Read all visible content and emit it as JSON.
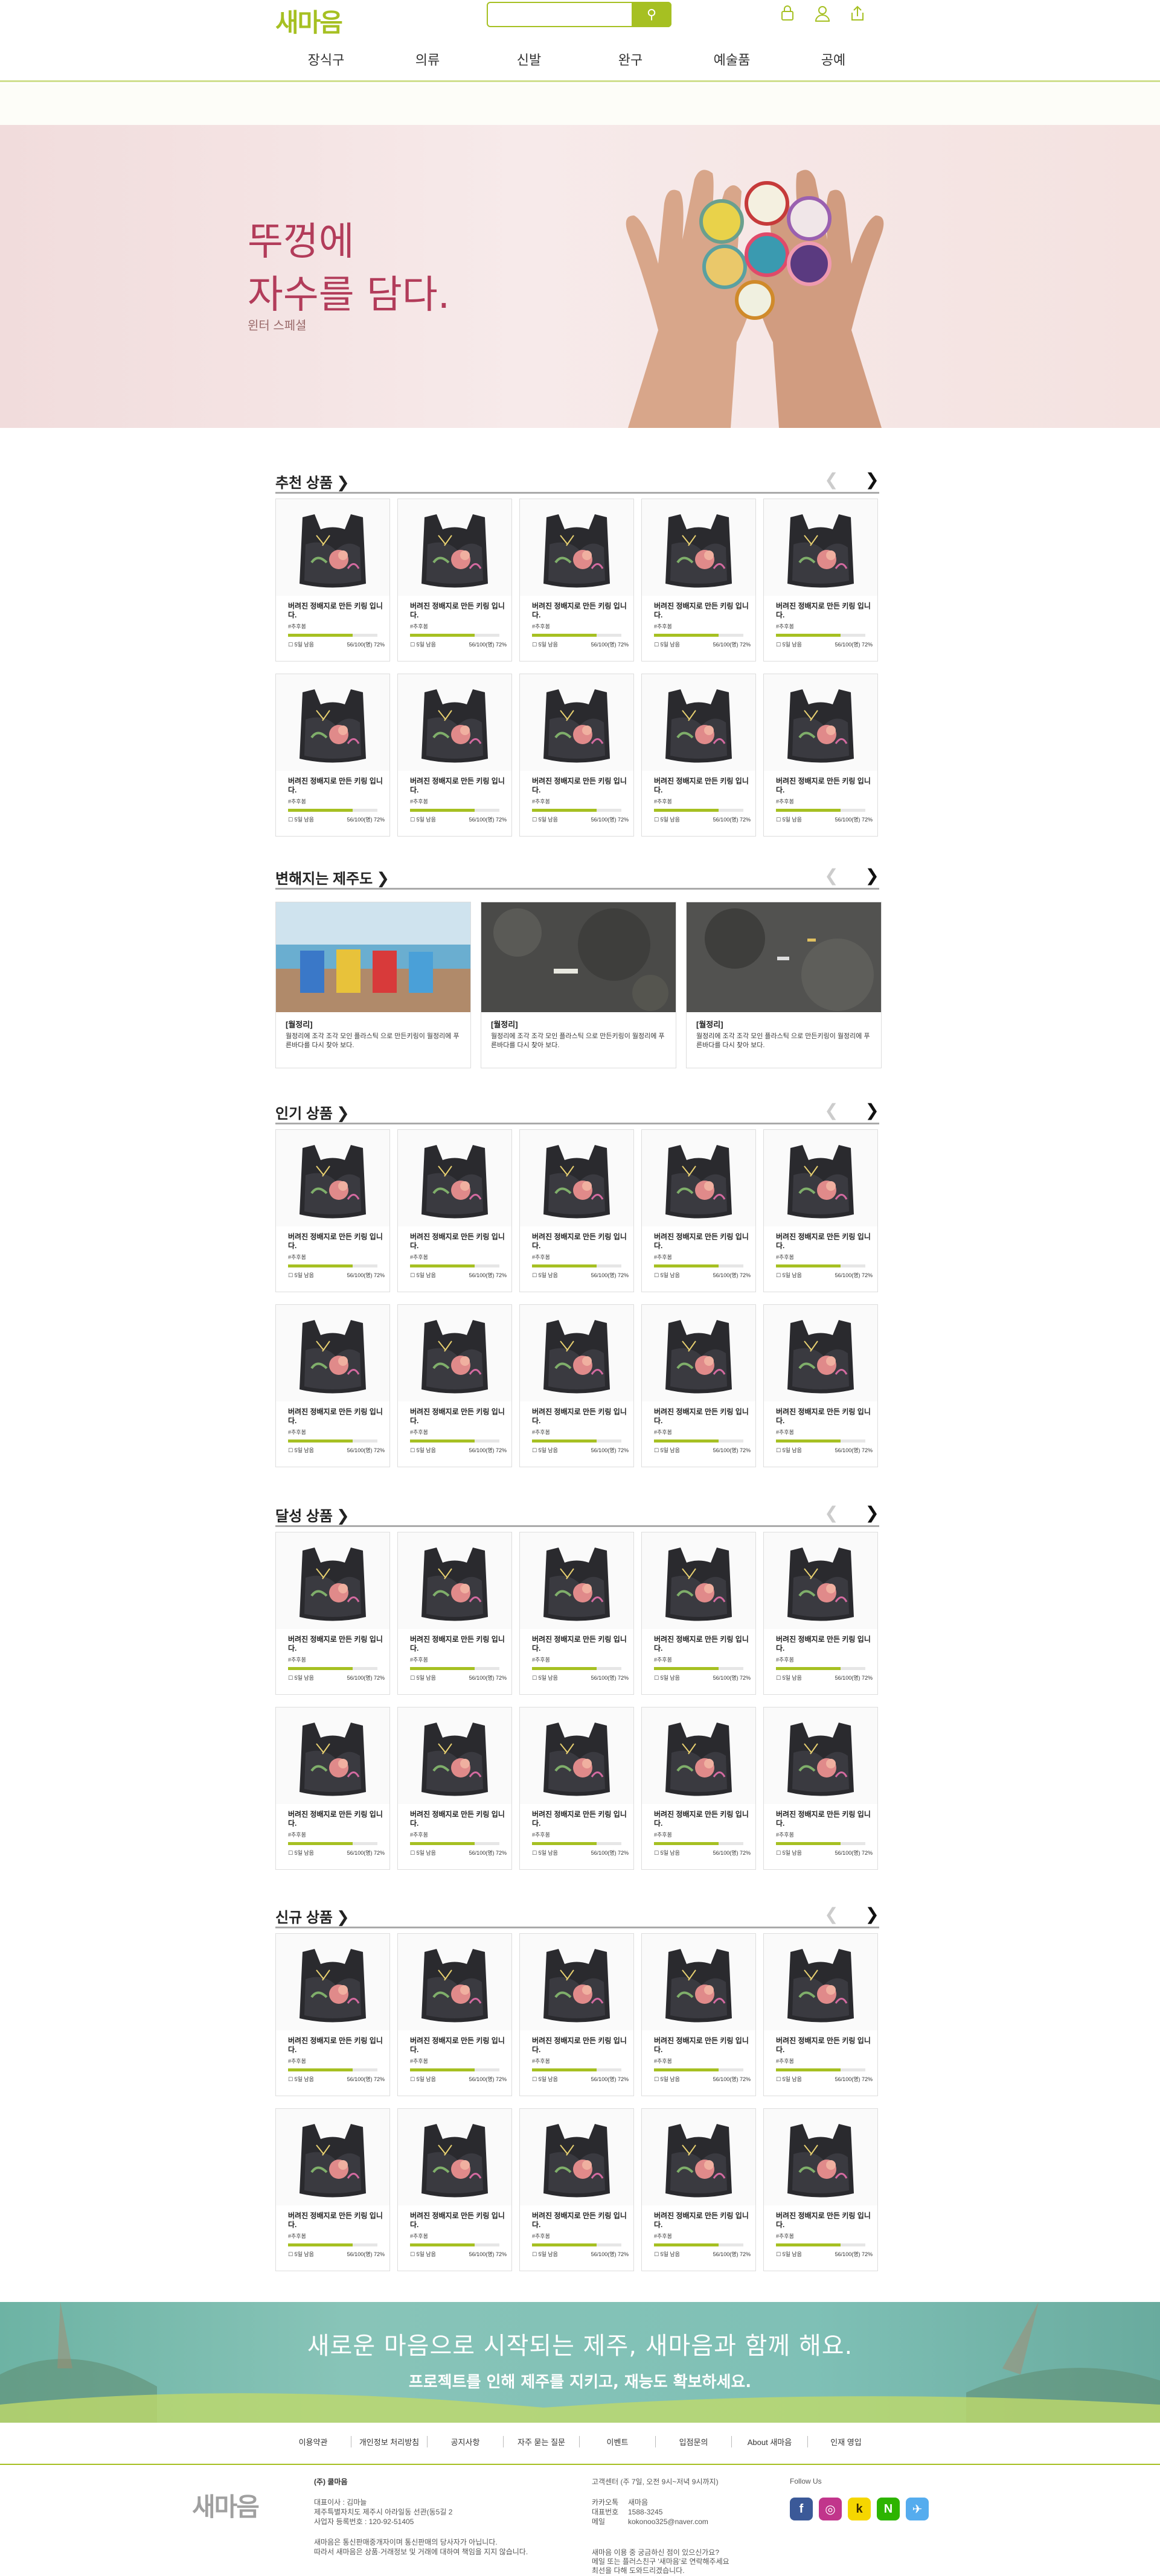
{
  "header": {
    "logo": "새마음",
    "search_placeholder": "",
    "search_icon": "search-icon",
    "icons": [
      "bag-icon",
      "user-icon",
      "share-icon"
    ]
  },
  "nav": [
    "장식구",
    "의류",
    "신발",
    "완구",
    "예술품",
    "공예"
  ],
  "hero": {
    "line1": "뚜껑에",
    "line2": "자수를 담다.",
    "sub": "윈터 스페셜"
  },
  "product": {
    "name": "버려진 정배지로 만든 키링 입니다.",
    "keyword": "#추후봄",
    "remain": "5일 남음",
    "progress_text": "56/100(명) 72%",
    "progress": 0.72
  },
  "sections": {
    "recommend": "추천 상품",
    "jeju": "변해지는 제주도",
    "popular": "인기 상품",
    "achieved": "달성 상품",
    "new": "신규 상품"
  },
  "jeju_cards": [
    {
      "title": "[월정리]",
      "desc": "월정리에 조각 조각 모인 플라스틱 으로 만든키링이 월정리에 푸른바다를 다시 찾아 보다."
    },
    {
      "title": "[월정리]",
      "desc": "월정리에 조각 조각 모인 플라스틱 으로 만든키링이 월정리에 푸른바다를 다시 찾아 보다."
    },
    {
      "title": "[월정리]",
      "desc": "월정리에 조각 조각 모인 플라스틱 으로 만든키링이 월정리에 푸른바다를 다시 찾아 보다."
    }
  ],
  "banner": {
    "line1": "새로운 마음으로 시작되는 제주, 새마음과 함께 해요.",
    "line2": "프로젝트를 인해 제주를 지키고, 재능도 확보하세요."
  },
  "footer": {
    "nav": [
      "이용약관",
      "개인정보 처리방침",
      "공지사항",
      "자주 묻는 질문",
      "이벤트",
      "입점문의",
      "About 새마음",
      "인재 영입"
    ],
    "logo": "새마음",
    "company": "(주) 쿨마음",
    "info_lines": [
      "대표이사 : 김마늘",
      "제주특별자치도 제주시 아라일동 선관(동5길 2",
      "사업자 등록번호 : 120-92-51405"
    ],
    "fine_lines": [
      "새마음은 통신판매중개자이며 통신판매의 당사자가 아닙니다.",
      "따라서 새마음은 상품·거래정보 및 거래에 대하여 책임을 지지 않습니다."
    ],
    "cs_title": "고객센터 (주 7일, 오전 9시~저녁 9시까지)",
    "cs_rows": [
      {
        "k": "카카오톡",
        "v": "새마음"
      },
      {
        "k": "대표번호",
        "v": "1588-3245"
      },
      {
        "k": "메일",
        "v": "kokonoo325@naver.com"
      }
    ],
    "cs_note": [
      "새마음 이용 중 궁금하신 점이 있으신가요?",
      "메일 또는 플러스친구 '새마음'로 연락해주세요",
      "최선을 다해 도와드리겠습니다."
    ],
    "follow": "Follow Us",
    "social": [
      "facebook-icon",
      "instagram-icon",
      "kakao-icon",
      "naver-icon",
      "twitter-icon"
    ]
  }
}
